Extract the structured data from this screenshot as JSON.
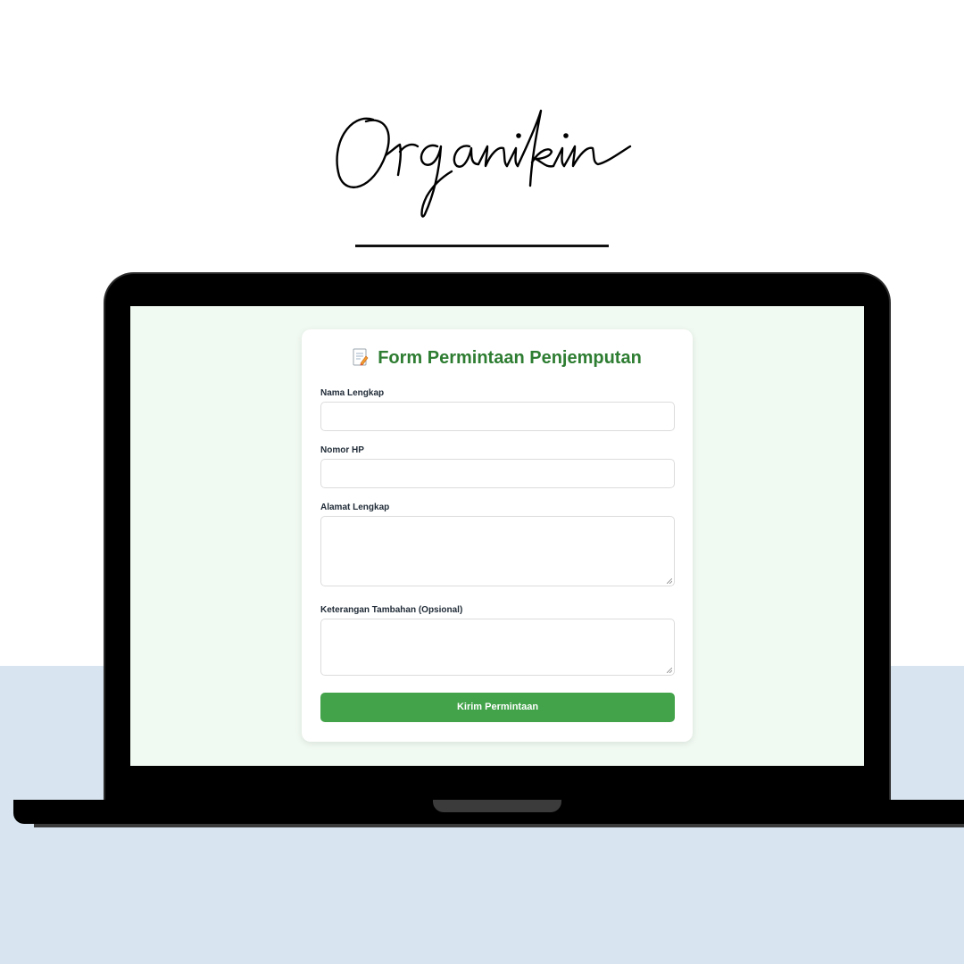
{
  "brand": {
    "logo_text": "Organikin"
  },
  "form": {
    "title": "Form Permintaan Penjemputan",
    "title_icon": "memo-icon",
    "fields": [
      {
        "label": "Nama Lengkap",
        "type": "text",
        "value": ""
      },
      {
        "label": "Nomor HP",
        "type": "text",
        "value": ""
      },
      {
        "label": "Alamat Lengkap",
        "type": "textarea",
        "value": ""
      },
      {
        "label": "Keterangan Tambahan (Opsional)",
        "type": "textarea",
        "value": ""
      }
    ],
    "submit_label": "Kirim Permintaan"
  },
  "colors": {
    "accent": "#2e7d32",
    "button": "#43a34a",
    "screen_background": "#f1faf2",
    "page_bottom": "#d8e5f0"
  }
}
